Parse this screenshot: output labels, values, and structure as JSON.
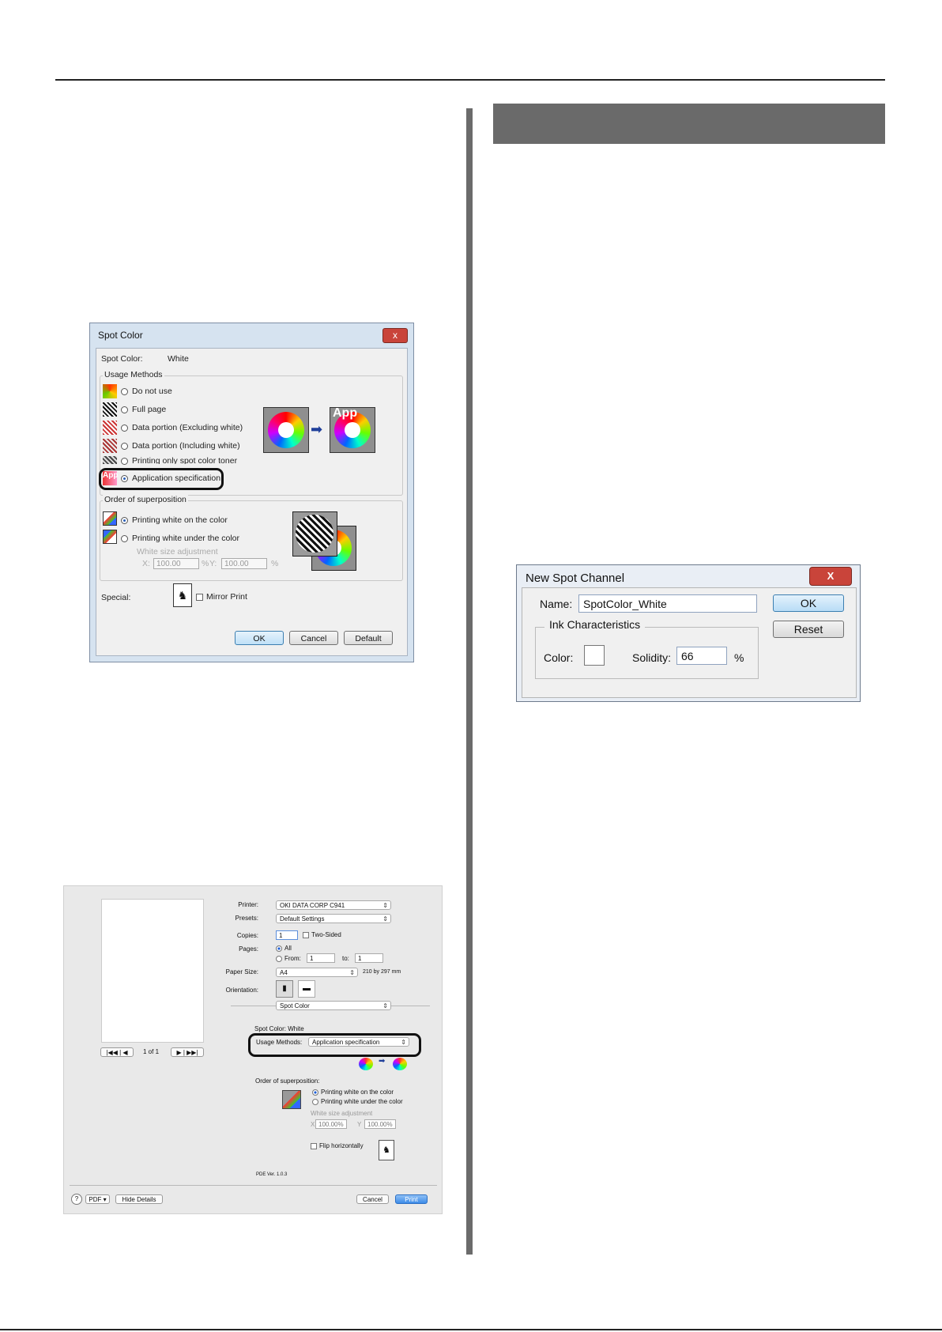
{
  "spot_color_dialog": {
    "title": "Spot Color",
    "close": "x",
    "spot_color_label": "Spot Color:",
    "spot_color_value": "White",
    "usage_group": "Usage Methods",
    "usage_options": [
      "Do not use",
      "Full page",
      "Data portion (Excluding white)",
      "Data portion (Including white)",
      "Printing only spot color toner",
      "Application specification"
    ],
    "app_badge": "App",
    "order_group": "Order of superposition",
    "order_options": [
      "Printing white on the color",
      "Printing white under the color"
    ],
    "white_size_label": "White size adjustment",
    "x_label": "X:",
    "x_value": "100.00",
    "y_label": "Y:",
    "y_value": "100.00",
    "pct": "%",
    "special_label": "Special:",
    "mirror_print": "Mirror Print",
    "ok": "OK",
    "cancel": "Cancel",
    "default": "Default"
  },
  "new_spot_channel": {
    "title": "New Spot Channel",
    "close": "X",
    "name_label": "Name:",
    "name_value": "SpotColor_White",
    "ink_group": "Ink Characteristics",
    "color_label": "Color:",
    "solidity_label": "Solidity:",
    "solidity_value": "66",
    "pct": "%",
    "ok": "OK",
    "reset": "Reset"
  },
  "mac_print": {
    "printer_label": "Printer:",
    "printer_value": "OKI DATA CORP C941",
    "presets_label": "Presets:",
    "presets_value": "Default Settings",
    "copies_label": "Copies:",
    "copies_value": "1",
    "two_sided": "Two-Sided",
    "pages_label": "Pages:",
    "pages_all": "All",
    "pages_from": "From:",
    "from_value": "1",
    "to_label": "to:",
    "to_value": "1",
    "paper_size_label": "Paper Size:",
    "paper_size_value": "A4",
    "paper_dims": "210 by 297 mm",
    "orientation_label": "Orientation:",
    "panel_value": "Spot Color",
    "spot_color_line": "Spot Color: White",
    "usage_label": "Usage Methods:",
    "usage_value": "Application specification",
    "order_label": "Order of superposition:",
    "order_on": "Printing white on the color",
    "order_under": "Printing white under the color",
    "white_size": "White size adjustment",
    "x_label": "X",
    "x_value": "100.00%",
    "y_label": "Y",
    "y_value": "100.00%",
    "flip": "Flip horizontally",
    "pdf_ver": "PDE Ver.  1.0.3",
    "page_counter": "1 of 1",
    "help": "?",
    "pdf_button": "PDF ▾",
    "hide_details": "Hide Details",
    "cancel": "Cancel",
    "print": "Print"
  }
}
